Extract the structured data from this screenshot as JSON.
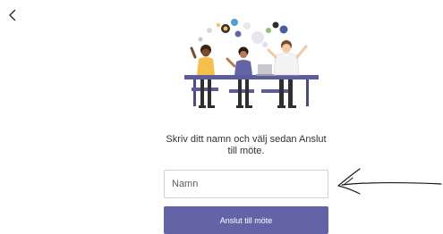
{
  "nav": {
    "back_icon": "chevron-left-icon"
  },
  "illustration": {
    "description_icon": "people-meeting-illustration"
  },
  "prompt": {
    "line1": "Skriv ditt namn och välj sedan Anslut",
    "line2": "till möte."
  },
  "name_input": {
    "placeholder": "Namn",
    "value": ""
  },
  "join_button": {
    "label": "Anslut till möte"
  },
  "annotation": {
    "icon": "hand-drawn-arrow-icon"
  },
  "colors": {
    "accent": "#6264a7",
    "text": "#323130",
    "border": "#d2d0ce"
  }
}
